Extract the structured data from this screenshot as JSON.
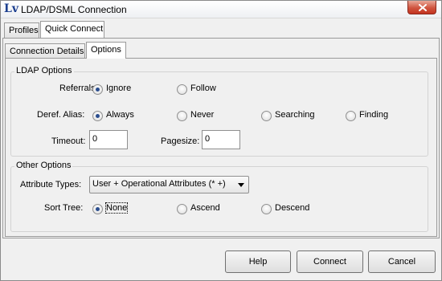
{
  "window": {
    "title": "LDAP/DSML Connection",
    "logo_text": "Lv"
  },
  "outer_tabs": [
    {
      "label": "Profiles",
      "active": false
    },
    {
      "label": "Quick Connect",
      "active": true
    }
  ],
  "inner_tabs": [
    {
      "label": "Connection Details",
      "active": false
    },
    {
      "label": "Options",
      "active": true
    }
  ],
  "ldap_options": {
    "title": "LDAP Options",
    "referrals": {
      "label": "Referrals:",
      "options": [
        "Ignore",
        "Follow"
      ],
      "selected": "Ignore"
    },
    "deref_alias": {
      "label": "Deref. Alias:",
      "options": [
        "Always",
        "Never",
        "Searching",
        "Finding"
      ],
      "selected": "Always"
    },
    "timeout": {
      "label": "Timeout:",
      "value": "0"
    },
    "pagesize": {
      "label": "Pagesize:",
      "value": "0"
    }
  },
  "other_options": {
    "title": "Other Options",
    "attribute_types": {
      "label": "Attribute Types:",
      "value": "User + Operational Attributes (* +)"
    },
    "sort_tree": {
      "label": "Sort Tree:",
      "options": [
        "None",
        "Ascend",
        "Descend"
      ],
      "selected": "None"
    }
  },
  "buttons": {
    "help": "Help",
    "connect": "Connect",
    "cancel": "Cancel"
  },
  "colors": {
    "window_bg": "#f0f0f0",
    "close_button": "#c9402b",
    "logo": "#1c3f8f",
    "radio_selected": "#2a4d8e"
  }
}
